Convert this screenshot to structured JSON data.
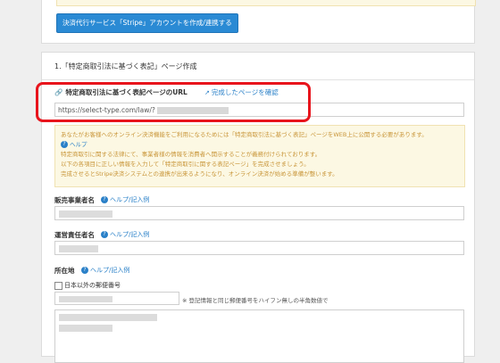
{
  "top": {
    "stripe_button": "決済代行サービス「Stripe」アカウントを作成/連携する"
  },
  "section": {
    "title": "1.「特定商取引法に基づく表記」ページ作成",
    "url_label": "特定商取引法に基づく表記ページのURL",
    "confirm_link": "完成したページを確認",
    "url_value": "https://select-type.com/law/?"
  },
  "info": {
    "lines": [
      "あなたがお客様へのオンライン決済機能をご利用になるためには「特定商取引法に基づく表記」ページをWEB上に公開する必要があります。",
      "特定商取引に関する法律にて、事業者様の情報を消費者へ開示することが義務付けられております。",
      "以下の各項目に正しい情報を入力して「特定商取引に関する表記ページ」を完成させましょう。",
      "完成させるとStripe決済システムとの連携が出来るようになり、オンライン決済が始める準備が整います。"
    ],
    "help": "ヘルプ"
  },
  "fields": {
    "seller_label": "販売事業者名",
    "seller_help": "ヘルプ/記入例",
    "manager_label": "運営責任者名",
    "manager_help": "ヘルプ/記入例",
    "address_label": "所在地",
    "address_help": "ヘルプ/記入例",
    "overseas_check": "日本以外の郵便番号",
    "postal_note": "※ 登記情報と同じ郵便番号をハイフン無しの半角数値で"
  }
}
